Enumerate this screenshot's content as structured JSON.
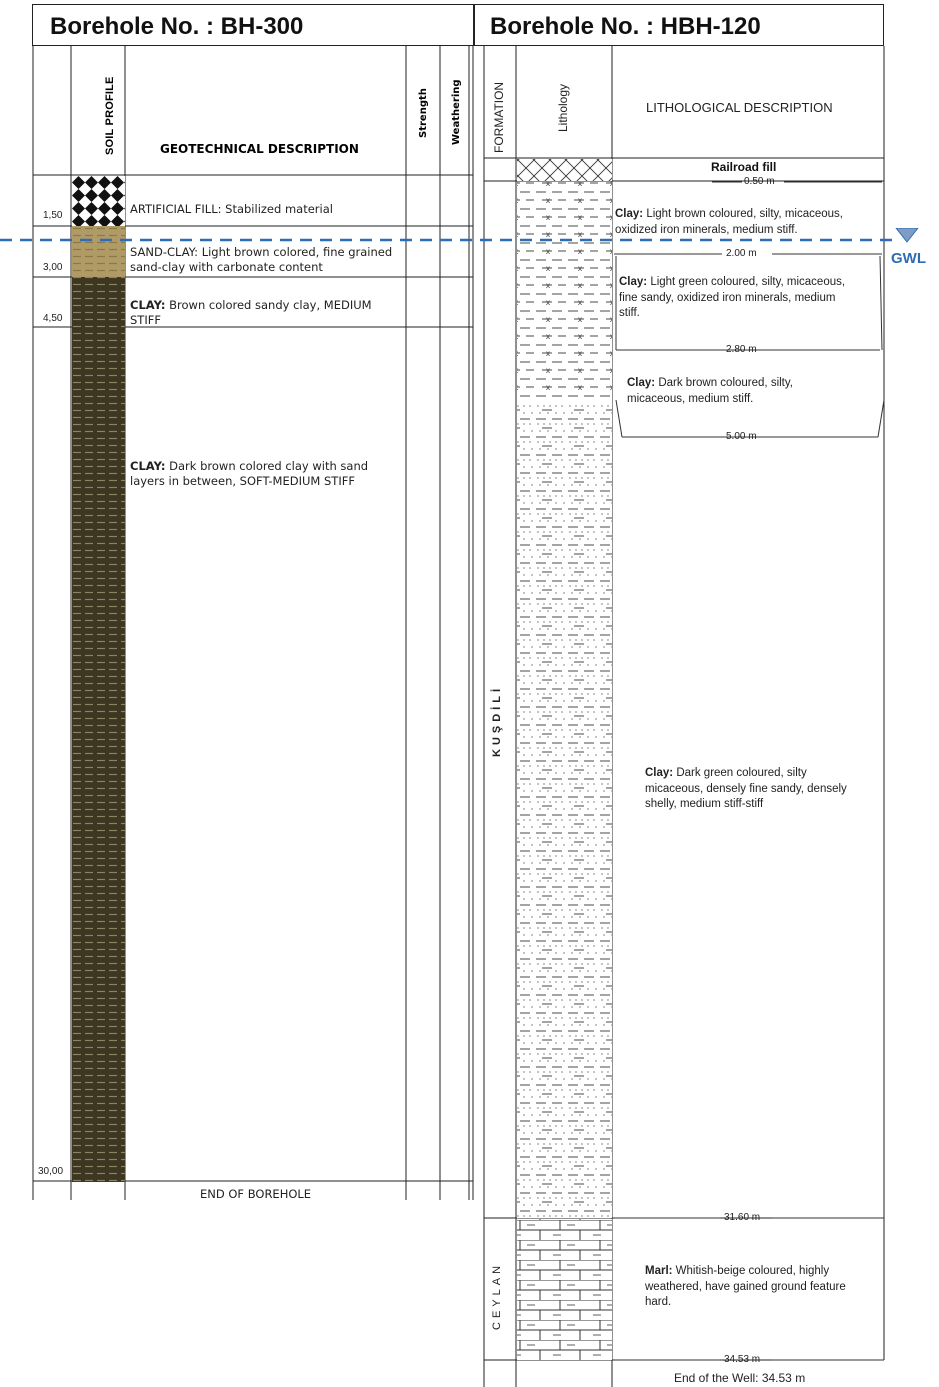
{
  "left": {
    "title": "Borehole No. : BH-300",
    "headers": {
      "soil_profile": "SOIL PROFILE",
      "description": "GEOTECHNICAL DESCRIPTION",
      "strength": "Strength",
      "weathering": "Weathering"
    },
    "depths": [
      "1,50",
      "3,00",
      "4,50",
      "30,00"
    ],
    "layers": [
      {
        "name": "ARTIFICIAL FILL:",
        "text": " Stabilized material"
      },
      {
        "name": "SAND-CLAY:",
        "text": " Light brown colored, fine grained sand-clay with carbonate content"
      },
      {
        "name": "CLAY:",
        "text": " Brown colored sandy clay, MEDIUM STIFF"
      },
      {
        "name": "CLAY:",
        "text": "  Dark brown colored clay with sand layers in between, SOFT-MEDIUM STIFF"
      }
    ],
    "end_label": "END OF BOREHOLE"
  },
  "right": {
    "title": "Borehole No. : HBH-120",
    "headers": {
      "formation": "FORMATION",
      "lithology": "Lithology",
      "description": "LITHOLOGICAL DESCRIPTION"
    },
    "formations": [
      "KUŞDİLİ",
      "CEYLAN"
    ],
    "top_label": "Railroad fill",
    "depth_markers": [
      "0.50 m",
      "2.00 m",
      "2.80 m",
      "5.00 m",
      "31.60 m",
      "34.53 m"
    ],
    "layers": [
      {
        "name": "Clay:",
        "text": " Light brown coloured, silty, micaceous, oxidized iron minerals, medium stiff."
      },
      {
        "name": "Clay:",
        "text": " Light green coloured, silty, micaceous, fine sandy, oxidized iron minerals, medium stiff."
      },
      {
        "name": "Clay:",
        "text": " Dark brown coloured, silty, micaceous, medium stiff."
      },
      {
        "name": "Clay:",
        "text": " Dark green coloured, silty micaceous, densely fine sandy, densely shelly, medium stiff-stiff"
      },
      {
        "name": "Marl:",
        "text": " Whitish-beige coloured, highly weathered, have gained ground feature hard."
      }
    ],
    "end_label": "End of the Well: 34.53 m"
  },
  "gwl_label": "GWL",
  "colors": {
    "gwl": "#2e6db5",
    "clay_dark": "#3d3621",
    "sand_clay": "#b09a66",
    "line": "#222222"
  }
}
